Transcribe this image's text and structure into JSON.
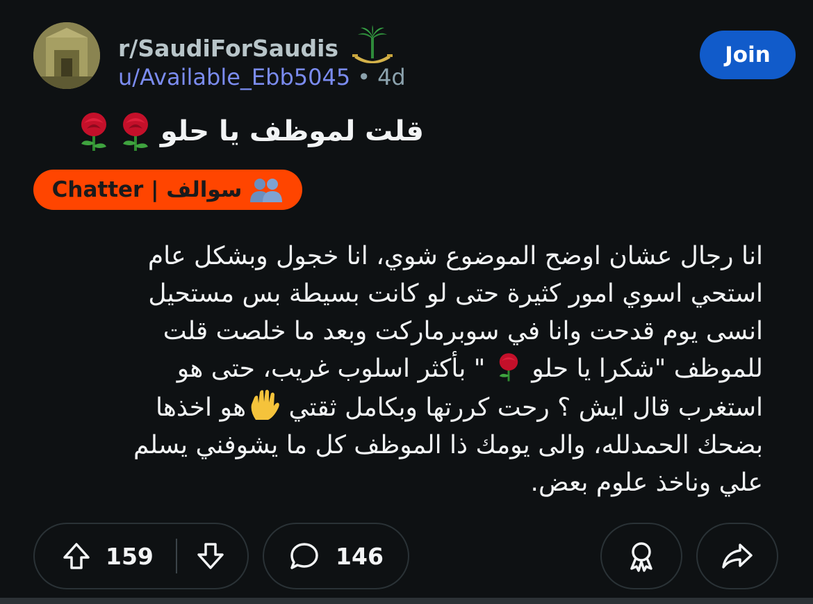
{
  "post": {
    "subreddit": "r/SaudiForSaudis",
    "author": "u/Available_Ebb5045",
    "separator": "•",
    "age": "4d",
    "join_label": "Join",
    "title": "قلت لموظف يا حلو",
    "flair": {
      "text": "Chatter | سوالف",
      "color": "#ff4500"
    },
    "body_lines": [
      "انا رجال عشان اوضح الموضوع شوي، انا خجول وبشكل عام",
      "استحي اسوي امور كثيرة حتى لو كانت بسيطة بس مستحيل",
      "انسى يوم قدحت وانا في سوبرماركت وبعد ما خلصت قلت",
      {
        "before": "للموظف \"شكرا يا حلو ",
        "after": " \" بأكثر اسلوب غريب، حتى هو"
      },
      {
        "before": "استغرب قال ايش ؟ رحت كررتها وبكامل ثقتي ",
        "after": "هو اخذها"
      },
      "بضحك الحمدلله، والى يومك ذا الموظف كل ما يشوفني يسلم",
      "علي وناخذ علوم بعض."
    ]
  },
  "actions": {
    "upvotes": "159",
    "comments": "146"
  },
  "icons": [
    "upvote-icon",
    "downvote-icon",
    "comment-icon",
    "award-icon",
    "share-icon",
    "rose-icon",
    "raised-hand-icon",
    "people-icon",
    "palm-swords-emblem"
  ],
  "colors": {
    "background": "#0e1113",
    "join_button": "#115bca",
    "username": "#7b8cf0",
    "flair": "#ff4500"
  }
}
